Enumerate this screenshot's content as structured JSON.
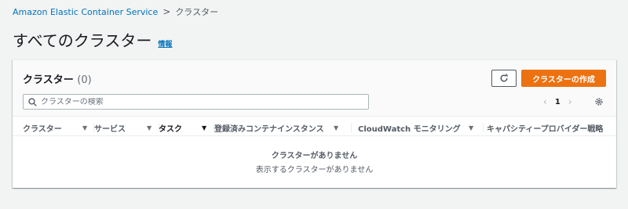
{
  "breadcrumb": {
    "root": "Amazon Elastic Container Service",
    "separator": ">",
    "current": "クラスター"
  },
  "page": {
    "title": "すべてのクラスター",
    "info_link": "情報"
  },
  "panel": {
    "title": "クラスター",
    "count": "(0)",
    "create_button": "クラスターの作成",
    "refresh_icon": "refresh-icon",
    "search": {
      "placeholder": "クラスターの検索",
      "value": ""
    },
    "pagination": {
      "prev": "‹",
      "current_page": "1",
      "next": "›"
    },
    "columns": [
      {
        "label": "クラスター",
        "sort": "none"
      },
      {
        "label": "サービス",
        "sort": "none"
      },
      {
        "label": "タスク",
        "sort": "active"
      },
      {
        "label": "登録済みコンテナインスタンス",
        "sort": "none"
      },
      {
        "label": "CloudWatch モニタリング",
        "sort": "none"
      },
      {
        "label": "キャパシティープロバイダー戦略",
        "sort": "none"
      }
    ],
    "empty": {
      "title": "クラスターがありません",
      "subtitle": "表示するクラスターがありません"
    }
  },
  "colors": {
    "accent": "#ec7211",
    "link": "#0073bb",
    "background": "#f2f3f3"
  }
}
